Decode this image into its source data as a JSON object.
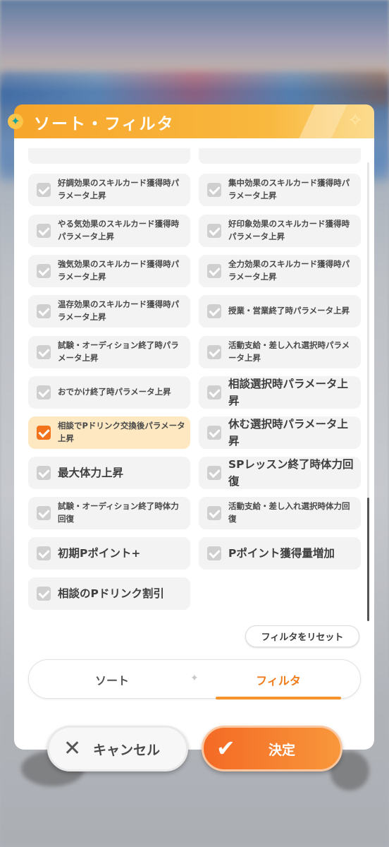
{
  "header": {
    "title": "ソート・フィルタ"
  },
  "filters": [
    {
      "label": "好調効果のスキルカード獲得時パラメータ上昇",
      "checked": true,
      "big": false
    },
    {
      "label": "集中効果のスキルカード獲得時パラメータ上昇",
      "checked": true,
      "big": false
    },
    {
      "label": "やる気効果のスキルカード獲得時パラメータ上昇",
      "checked": true,
      "big": false
    },
    {
      "label": "好印象効果のスキルカード獲得時パラメータ上昇",
      "checked": true,
      "big": false
    },
    {
      "label": "強気効果のスキルカード獲得時パラメータ上昇",
      "checked": true,
      "big": false
    },
    {
      "label": "全力効果のスキルカード獲得時パラメータ上昇",
      "checked": true,
      "big": false
    },
    {
      "label": "温存効果のスキルカード獲得時パラメータ上昇",
      "checked": true,
      "big": false
    },
    {
      "label": "授業・営業終了時パラメータ上昇",
      "checked": true,
      "big": false
    },
    {
      "label": "試験・オーディション終了時パラメータ上昇",
      "checked": true,
      "big": false
    },
    {
      "label": "活動支給・差し入れ選択時パラメータ上昇",
      "checked": true,
      "big": false
    },
    {
      "label": "おでかけ終了時パラメータ上昇",
      "checked": true,
      "big": false
    },
    {
      "label": "相談選択時パラメータ上昇",
      "checked": true,
      "big": true
    },
    {
      "label": "相談でPドリンク交換後パラメータ上昇",
      "checked": true,
      "big": false,
      "highlight": true
    },
    {
      "label": "休む選択時パラメータ上昇",
      "checked": true,
      "big": true
    },
    {
      "label": "最大体力上昇",
      "checked": true,
      "big": true
    },
    {
      "label": "SPレッスン終了時体力回復",
      "checked": true,
      "big": true
    },
    {
      "label": "試験・オーディション終了時体力回復",
      "checked": true,
      "big": false
    },
    {
      "label": "活動支給・差し入れ選択時体力回復",
      "checked": true,
      "big": false
    },
    {
      "label": "初期Pポイント+",
      "checked": true,
      "big": true
    },
    {
      "label": "Pポイント獲得量増加",
      "checked": true,
      "big": true
    },
    {
      "label": "相談のPドリンク割引",
      "checked": true,
      "big": true
    }
  ],
  "reset_label": "フィルタをリセット",
  "tabs": {
    "sort": "ソート",
    "filter": "フィルタ",
    "active": "filter"
  },
  "buttons": {
    "cancel": "キャンセル",
    "ok": "決定"
  },
  "colors": {
    "accent": "#f2731c",
    "header": "#f7a52b"
  }
}
